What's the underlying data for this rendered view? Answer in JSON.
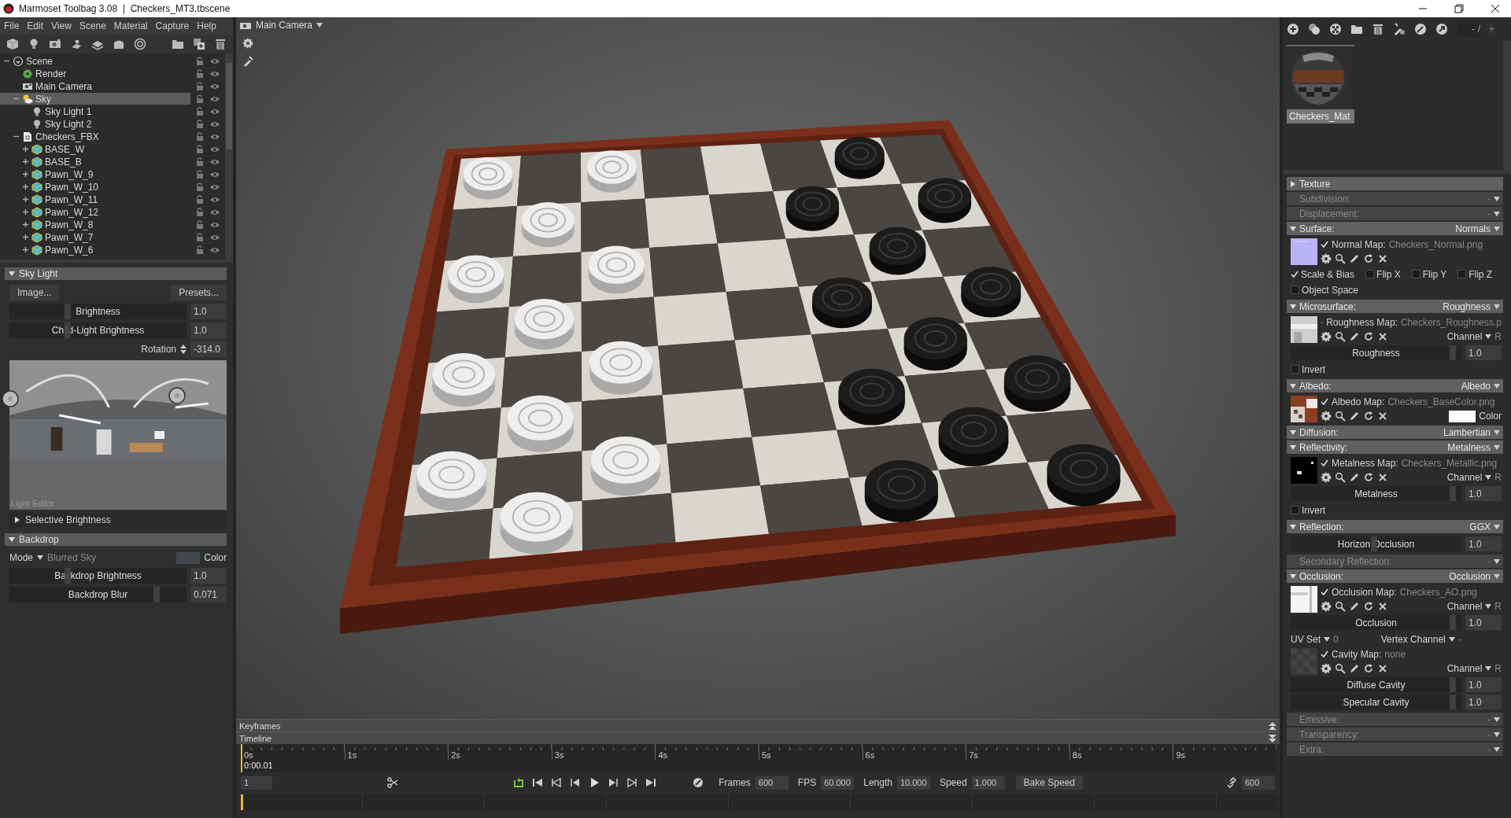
{
  "window": {
    "title": "Marmoset Toolbag 3.08  |  Checkers_MT3.tbscene"
  },
  "menu": [
    "File",
    "Edit",
    "View",
    "Scene",
    "Material",
    "Capture",
    "Help"
  ],
  "scene_tree": [
    {
      "label": "Scene",
      "kind": "scene",
      "expanded": true,
      "selected": false,
      "children": [
        {
          "label": "Render",
          "kind": "render",
          "selected": false
        },
        {
          "label": "Main Camera",
          "kind": "camera",
          "selected": false
        },
        {
          "label": "Sky",
          "kind": "sky",
          "expanded": true,
          "selected": true,
          "children": [
            {
              "label": "Sky Light 1",
              "kind": "light",
              "selected": false
            },
            {
              "label": "Sky Light 2",
              "kind": "light",
              "selected": false
            }
          ]
        },
        {
          "label": "Checkers_FBX",
          "kind": "fbx",
          "expanded": true,
          "selected": false,
          "children": [
            {
              "label": "BASE_W",
              "kind": "mesh",
              "expanded": false,
              "selected": false
            },
            {
              "label": "BASE_B",
              "kind": "mesh",
              "expanded": false,
              "selected": false
            },
            {
              "label": "Pawn_W_9",
              "kind": "mesh",
              "expanded": false,
              "selected": false
            },
            {
              "label": "Pawn_W_10",
              "kind": "mesh",
              "expanded": false,
              "selected": false
            },
            {
              "label": "Pawn_W_11",
              "kind": "mesh",
              "expanded": false,
              "selected": false
            },
            {
              "label": "Pawn_W_12",
              "kind": "mesh",
              "expanded": false,
              "selected": false
            },
            {
              "label": "Pawn_W_8",
              "kind": "mesh",
              "expanded": false,
              "selected": false
            },
            {
              "label": "Pawn_W_7",
              "kind": "mesh",
              "expanded": false,
              "selected": false
            },
            {
              "label": "Pawn_W_6",
              "kind": "mesh",
              "expanded": false,
              "selected": false
            }
          ]
        }
      ]
    }
  ],
  "sky_light": {
    "title": "Sky Light",
    "expanded": true,
    "buttons": [
      "Image...",
      "Presets..."
    ],
    "sliders": [
      {
        "label": "Brightness",
        "value": "1.0",
        "level": 0.33
      },
      {
        "label": "Child-Light Brightness",
        "value": "1.0",
        "level": 0.33
      }
    ],
    "rotation": {
      "label": "Rotation",
      "value": "-314.0"
    },
    "preview_label": "Light Editor",
    "selective_brightness": {
      "label": "Selective Brightness",
      "expanded": false
    }
  },
  "backdrop": {
    "title": "Backdrop",
    "expanded": true,
    "mode_label": "Mode",
    "mode": "Blurred Sky",
    "color_label": "Color",
    "sliders": [
      {
        "label": "Backdrop Brightness",
        "value": "1.0",
        "level": 0.33
      },
      {
        "label": "Backdrop Blur",
        "value": "0.071",
        "level": 0.83
      }
    ]
  },
  "viewport": {
    "camera": "Main Camera"
  },
  "material_toolbar": {
    "page": "- /",
    "add": "+"
  },
  "material": {
    "name": "Checkers_Mat",
    "selected": true
  },
  "material_sections": [
    {
      "title": "Texture",
      "expanded": false
    },
    {
      "title": "Subdivision:",
      "value": "-",
      "enabled": false
    },
    {
      "title": "Displacement:",
      "value": "-",
      "enabled": false
    },
    {
      "title": "Surface:",
      "value": "Normals",
      "enabled": true,
      "expanded": true,
      "rows": [
        {
          "kind": "map",
          "checked": true,
          "label": "Normal Map:",
          "file": "Checkers_Normal.png"
        },
        {
          "kind": "checks",
          "items": [
            {
              "label": "Scale & Bias",
              "checked": true
            },
            {
              "label": "Flip X",
              "checked": false
            },
            {
              "label": "Flip Y",
              "checked": false
            },
            {
              "label": "Flip Z",
              "checked": false
            }
          ]
        },
        {
          "kind": "checks",
          "items": [
            {
              "label": "Object Space",
              "checked": false
            }
          ]
        }
      ]
    },
    {
      "title": "Microsurface:",
      "value": "Roughness",
      "enabled": true,
      "expanded": true,
      "rows": [
        {
          "kind": "map",
          "checked": true,
          "label": "Roughness Map:",
          "file": "Checkers_Roughness.p",
          "channel_label": "Channel",
          "channel": "R"
        },
        {
          "kind": "slider",
          "label": "Roughness",
          "value": "1.0",
          "level": 0.95
        },
        {
          "kind": "checks",
          "items": [
            {
              "label": "Invert",
              "checked": false
            }
          ]
        }
      ]
    },
    {
      "title": "Albedo:",
      "value": "Albedo",
      "enabled": true,
      "expanded": true,
      "rows": [
        {
          "kind": "map",
          "checked": true,
          "label": "Albedo Map:",
          "file": "Checkers_BaseColor.png",
          "color_label": "Color"
        }
      ]
    },
    {
      "title": "Diffusion:",
      "value": "Lambertian",
      "enabled": true,
      "expanded": true
    },
    {
      "title": "Reflectivity:",
      "value": "Metalness",
      "enabled": true,
      "expanded": true,
      "rows": [
        {
          "kind": "map",
          "checked": true,
          "label": "Metalness Map:",
          "file": "Checkers_Metallic.png",
          "channel_label": "Channel",
          "channel": "R"
        },
        {
          "kind": "slider",
          "label": "Metalness",
          "value": "1.0",
          "level": 0.95
        },
        {
          "kind": "checks",
          "items": [
            {
              "label": "Invert",
              "checked": false
            }
          ]
        }
      ]
    },
    {
      "title": "Reflection:",
      "value": "GGX",
      "enabled": true,
      "expanded": true,
      "rows": [
        {
          "kind": "slider",
          "label": "Horizon Occlusion",
          "value": "1.0",
          "level": 0.49
        }
      ]
    },
    {
      "title": "Secondary Reflection:",
      "value": "-",
      "enabled": false
    },
    {
      "title": "Occlusion:",
      "value": "Occlusion",
      "enabled": true,
      "expanded": true,
      "rows": [
        {
          "kind": "map",
          "checked": true,
          "label": "Occlusion Map:",
          "file": "Checkers_AO.png",
          "channel_label": "Channel",
          "channel": "R"
        },
        {
          "kind": "slider",
          "label": "Occlusion",
          "value": "1.0",
          "level": 0.95
        },
        {
          "kind": "dropdowns",
          "items": [
            {
              "label": "UV Set",
              "value": "0"
            },
            {
              "label": "Vertex Channel",
              "value": "-"
            }
          ]
        },
        {
          "kind": "map",
          "checked": true,
          "label": "Cavity Map:",
          "file": "none",
          "channel_label": "Channel",
          "channel": "R"
        },
        {
          "kind": "slider",
          "label": "Diffuse Cavity",
          "value": "1.0",
          "level": 0.95
        },
        {
          "kind": "slider",
          "label": "Specular Cavity",
          "value": "1.0",
          "level": 0.95
        }
      ]
    },
    {
      "title": "Emissive:",
      "value": "-",
      "enabled": false
    },
    {
      "title": "Transparency:",
      "value": "-",
      "enabled": false
    },
    {
      "title": "Extra:",
      "value": "-",
      "enabled": false
    }
  ],
  "keyframes": {
    "label": "Keyframes"
  },
  "timeline": {
    "label": "Timeline",
    "ticks": [
      "0s",
      "1s",
      "2s",
      "3s",
      "4s",
      "5s",
      "6s",
      "7s",
      "8s",
      "9s"
    ],
    "current_time": "0:00.01",
    "frame": "1",
    "loop": true,
    "fields": [
      {
        "label": "Frames",
        "value": "600"
      },
      {
        "label": "FPS",
        "value": "60.000"
      },
      {
        "label": "Length",
        "value": "10.000"
      },
      {
        "label": "Speed",
        "value": "1.000"
      }
    ],
    "bake_button": "Bake Speed",
    "end_frame": "600"
  }
}
